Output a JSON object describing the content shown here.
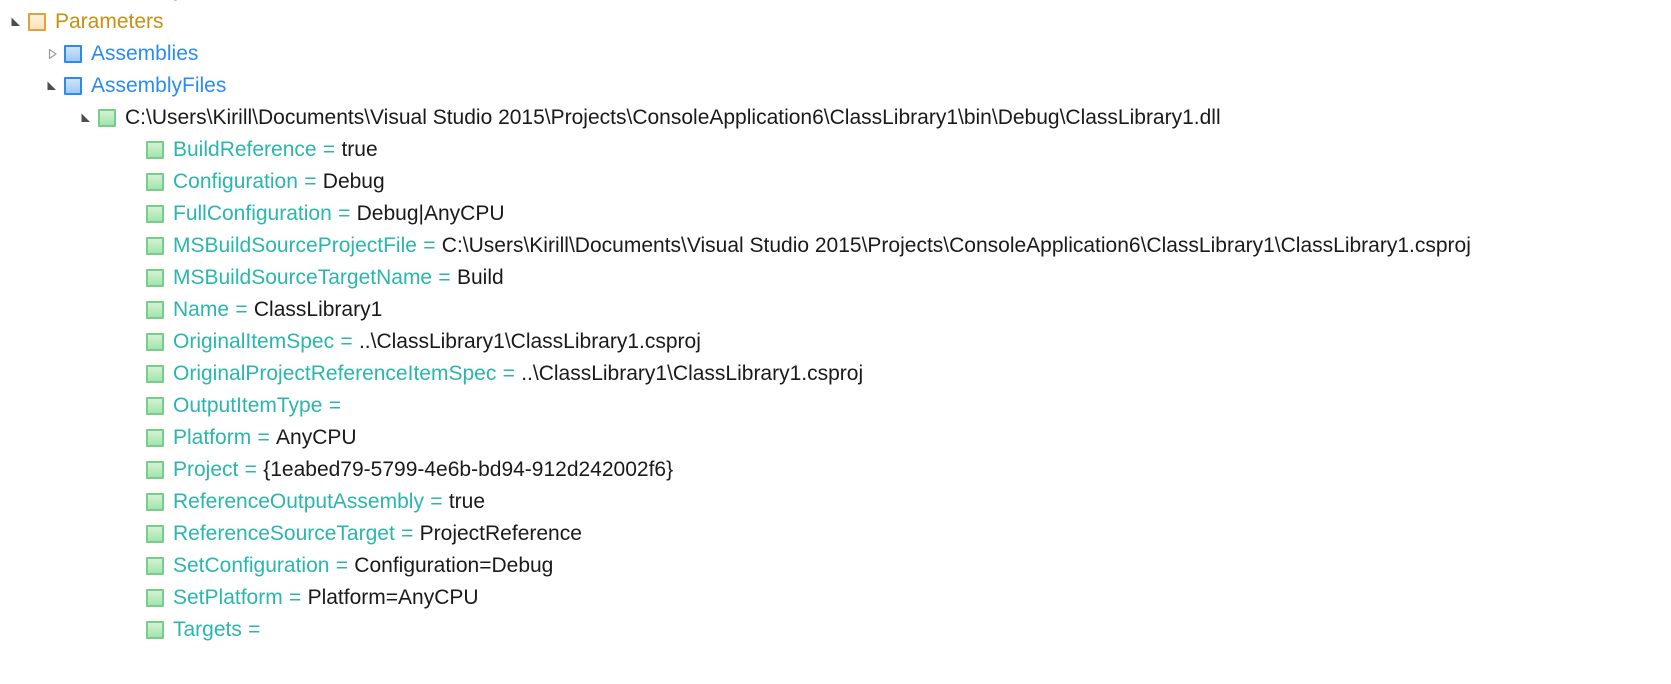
{
  "colors": {
    "folder_border": "#e0a33c",
    "folder_text": "#c8900f",
    "blue_border": "#2b8cf0",
    "blue_text": "#2b8cf0",
    "green_border": "#74cf88",
    "property_name": "#2bb6ad",
    "value_text": "#1a1a1a",
    "expander": "#4d4d4d",
    "background": "#ffffff"
  },
  "tree": {
    "clipped_top_row": {
      "label": "Assembly",
      "icon": "blue-square-icon"
    },
    "nodes": [
      {
        "label": "Parameters",
        "icon": "folder-square-icon",
        "expander": "expanded",
        "style": "folder"
      },
      {
        "label": "Assemblies",
        "icon": "blue-square-icon",
        "expander": "collapsed",
        "style": "blue"
      },
      {
        "label": "AssemblyFiles",
        "icon": "blue-square-icon",
        "expander": "expanded",
        "style": "blue"
      },
      {
        "label": "C:\\Users\\Kirill\\Documents\\Visual Studio 2015\\Projects\\ConsoleApplication6\\ClassLibrary1\\bin\\Debug\\ClassLibrary1.dll",
        "icon": "green-square-icon",
        "expander": "expanded",
        "style": "item"
      }
    ],
    "properties": [
      {
        "name": "BuildReference",
        "eq": "=",
        "value": "true"
      },
      {
        "name": "Configuration",
        "eq": "=",
        "value": "Debug"
      },
      {
        "name": "FullConfiguration",
        "eq": "=",
        "value": "Debug|AnyCPU"
      },
      {
        "name": "MSBuildSourceProjectFile",
        "eq": "=",
        "value": "C:\\Users\\Kirill\\Documents\\Visual Studio 2015\\Projects\\ConsoleApplication6\\ClassLibrary1\\ClassLibrary1.csproj"
      },
      {
        "name": "MSBuildSourceTargetName",
        "eq": "=",
        "value": "Build"
      },
      {
        "name": "Name",
        "eq": "=",
        "value": "ClassLibrary1"
      },
      {
        "name": "OriginalItemSpec",
        "eq": "=",
        "value": "..\\ClassLibrary1\\ClassLibrary1.csproj"
      },
      {
        "name": "OriginalProjectReferenceItemSpec",
        "eq": "=",
        "value": "..\\ClassLibrary1\\ClassLibrary1.csproj"
      },
      {
        "name": "OutputItemType",
        "eq": "=",
        "value": ""
      },
      {
        "name": "Platform",
        "eq": "=",
        "value": "AnyCPU"
      },
      {
        "name": "Project",
        "eq": "=",
        "value": "{1eabed79-5799-4e6b-bd94-912d242002f6}"
      },
      {
        "name": "ReferenceOutputAssembly",
        "eq": "=",
        "value": "true"
      },
      {
        "name": "ReferenceSourceTarget",
        "eq": "=",
        "value": "ProjectReference"
      },
      {
        "name": "SetConfiguration",
        "eq": "=",
        "value": "Configuration=Debug"
      },
      {
        "name": "SetPlatform",
        "eq": "=",
        "value": "Platform=AnyCPU"
      },
      {
        "name": "Targets",
        "eq": "=",
        "value": ""
      }
    ]
  }
}
